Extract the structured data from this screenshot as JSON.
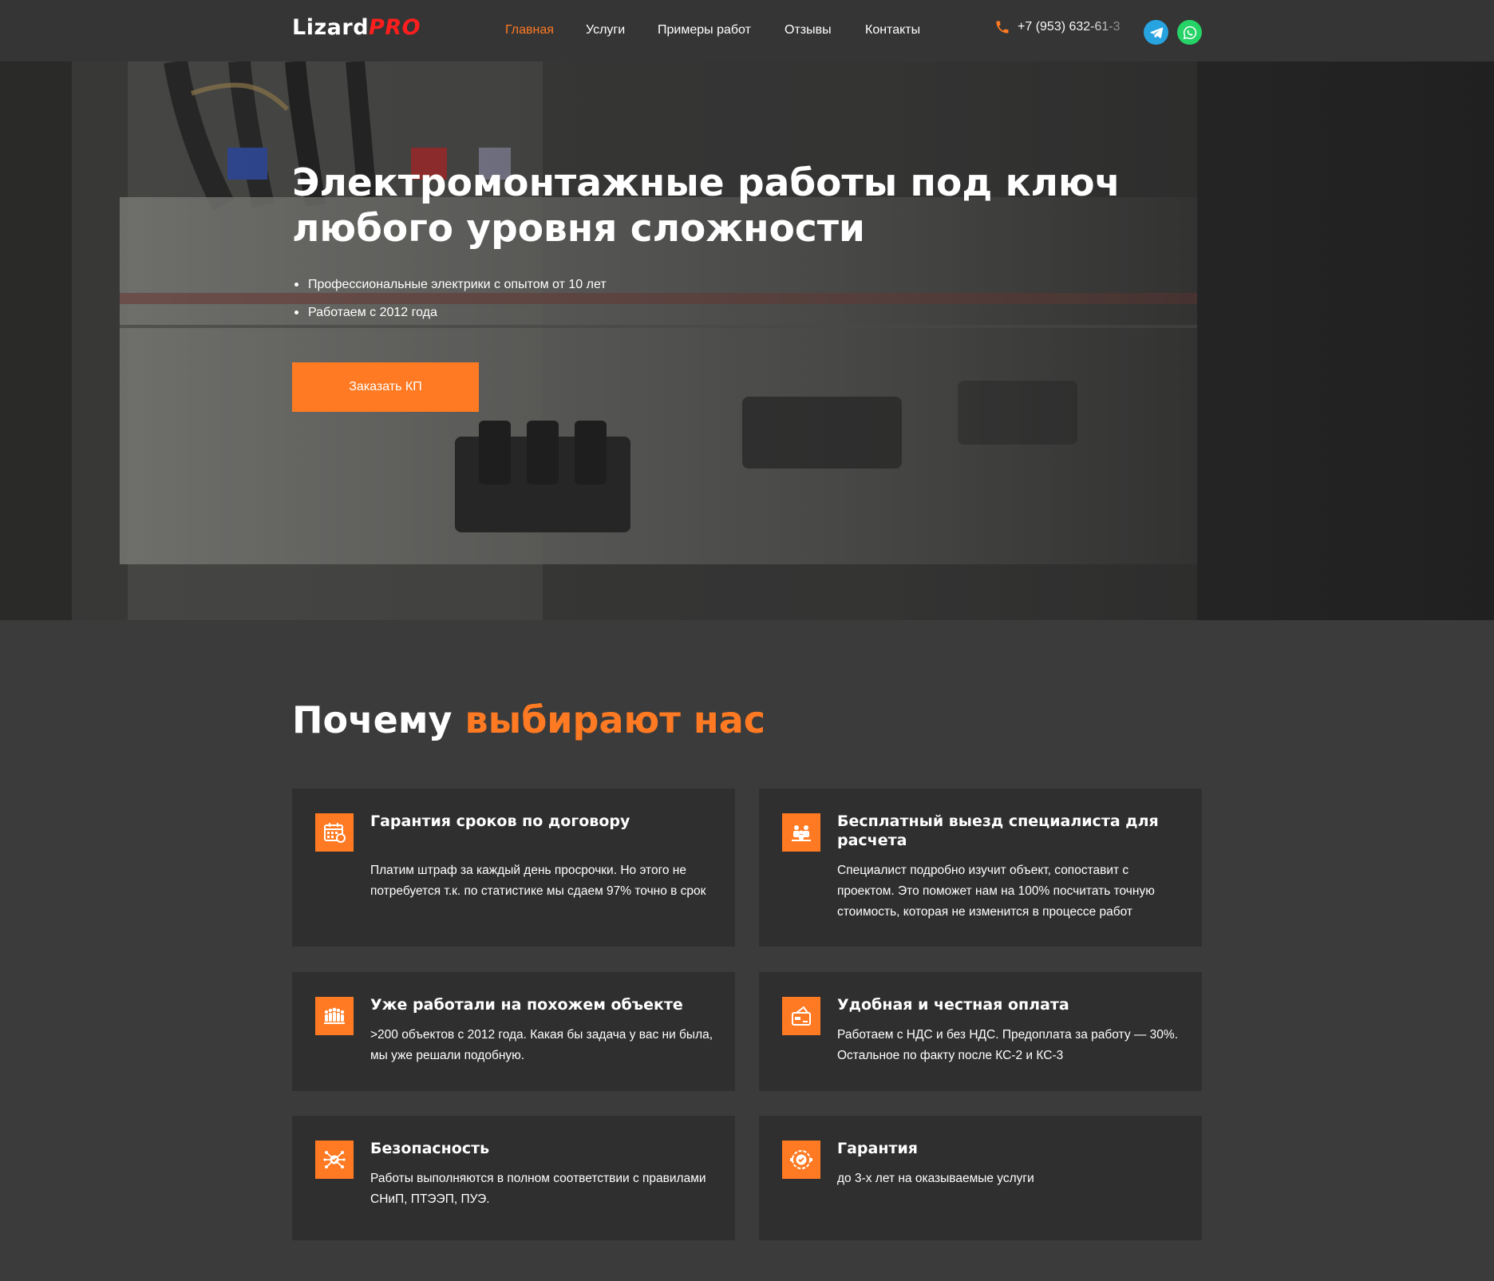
{
  "header": {
    "logo_part1": "Lizard",
    "logo_part2": "PRO",
    "nav": [
      "Главная",
      "Услуги",
      "Примеры работ",
      "Отзывы",
      "Контакты"
    ],
    "active_nav": "Главная",
    "phone": "+7 (953) 632-61-3",
    "phone_icon": "phone-icon",
    "socials": [
      "telegram-icon",
      "whatsapp-icon"
    ]
  },
  "hero": {
    "title": "Электромонтажные работы под ключ любого уровня сложности",
    "bullets": [
      "Профессиональные электрики с опытом от 10 лет",
      "Работаем с 2012 года"
    ],
    "cta_label": "Заказать КП"
  },
  "why": {
    "title_white": "Почему",
    "title_orange": "выбирают нас",
    "cards": [
      {
        "icon": "calendar-icon",
        "title": "Гарантия сроков по договору",
        "text": "Платим штраф за каждый день просрочки. Но этого не потребуется т.к. по статистике мы сдаем 97% точно в срок"
      },
      {
        "icon": "team-icon",
        "title": "Бесплатный выезд специалиста для расчета",
        "text": "Специалист подробно изучит объект, сопоставит с проектом. Это поможет нам на 100% посчитать точную стоимость, которая не изменится в процессе работ"
      },
      {
        "icon": "crowd-icon",
        "title": "Уже работали на похожем объекте",
        "text": ">200 объектов с 2012 года. Какая бы задача у вас ни была, мы уже решали подобную."
      },
      {
        "icon": "payment-card-icon",
        "title": "Удобная и честная оплата",
        "text": "Работаем с НДС и без НДС. Предоплата за работу — 30%. Остальное по факту после КС-2 и КС-3"
      },
      {
        "icon": "safety-network-icon",
        "title": "Безопасность",
        "text": "Работы выполняются в полном соответствии с правилами СНиП, ПТЭЭП, ПУЭ."
      },
      {
        "icon": "warranty-badge-icon",
        "title": "Гарантия",
        "text": "до 3-х лет на оказываемые услуги"
      }
    ]
  },
  "colors": {
    "accent": "#ff7a22",
    "logo_pro": "#ff1e1e",
    "header_bg": "#353535",
    "page_bg": "#3b3b3b",
    "card_bg": "#2f2f2f",
    "telegram": "#27a3e0",
    "whatsapp": "#25d366"
  }
}
